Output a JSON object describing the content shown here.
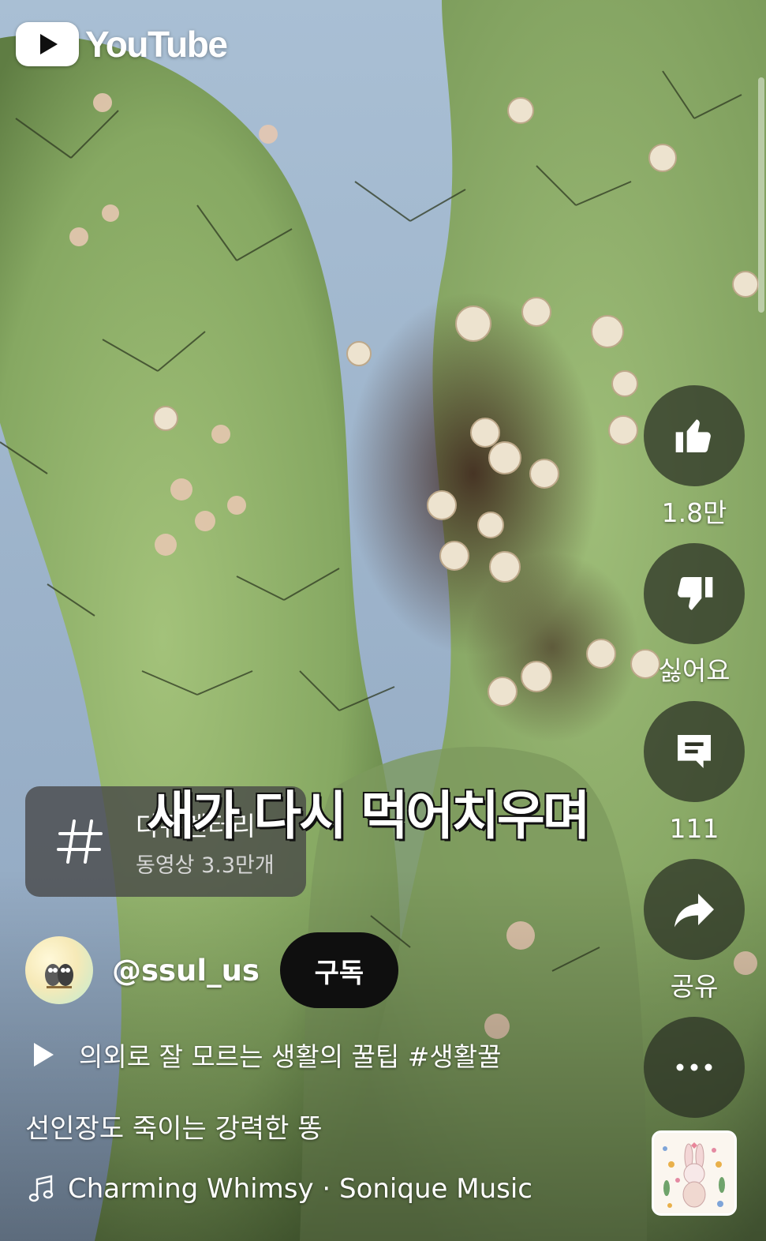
{
  "brand": {
    "wordmark": "YouTube"
  },
  "actions": {
    "like_count": "1.8만",
    "dislike_label": "싫어요",
    "comment_count": "111",
    "share_label": "공유"
  },
  "caption": "새가 다시 먹어치우며",
  "tag": {
    "title": "다큐멘터리",
    "subtitle": "동영상 3.3만개"
  },
  "channel": {
    "handle": "@ssul_us",
    "subscribe_label": "구독"
  },
  "playlist": {
    "label": "의외로 잘 모르는 생활의 꿀팁 #생활꿀"
  },
  "video": {
    "title": "선인장도 죽이는 강력한 똥"
  },
  "music": {
    "label": "Charming Whimsy · Sonique Music"
  },
  "colors": {
    "sky": "#9fb3c9",
    "cactus": "#8fae6d",
    "button_overlay": "#2e3224",
    "subscribe_bg": "#0f0f0f"
  }
}
